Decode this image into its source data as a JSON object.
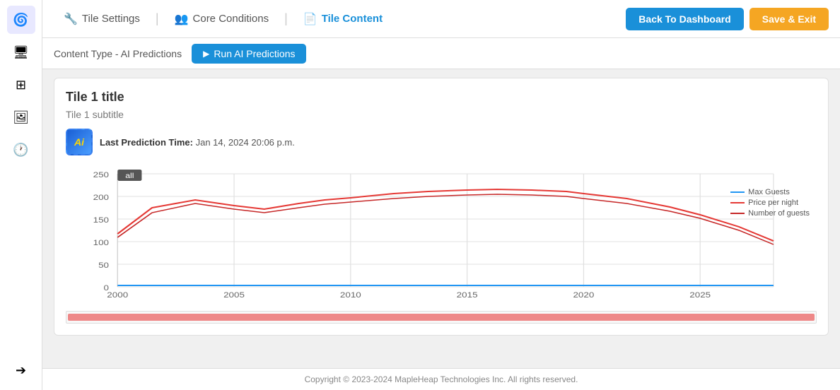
{
  "sidebar": {
    "icons": [
      {
        "name": "logo-icon",
        "symbol": "🌀",
        "active": true
      },
      {
        "name": "dashboard-icon",
        "symbol": "🖥"
      },
      {
        "name": "grid-icon",
        "symbol": "⊞"
      },
      {
        "name": "image-icon",
        "symbol": "🖼"
      },
      {
        "name": "clock-icon",
        "symbol": "🕐"
      },
      {
        "name": "arrow-right-icon",
        "symbol": "➔"
      }
    ]
  },
  "topnav": {
    "tabs": [
      {
        "id": "tile-settings",
        "icon": "🔧",
        "label": "Tile Settings",
        "active": false
      },
      {
        "id": "core-conditions",
        "icon": "👥",
        "label": "Core Conditions",
        "active": false
      },
      {
        "id": "tile-content",
        "icon": "📄",
        "label": "Tile Content",
        "active": true
      }
    ],
    "back_button": "Back To Dashboard",
    "save_button": "Save & Exit"
  },
  "subtoolbar": {
    "content_type_label": "Content Type - AI Predictions",
    "run_button": "Run AI Predictions"
  },
  "tile": {
    "title": "Tile 1 title",
    "subtitle": "Tile 1 subtitle",
    "ai_badge": "Ai",
    "prediction_label": "Last Prediction Time:",
    "prediction_time": "Jan 14, 2024 20:06 p.m."
  },
  "chart": {
    "y_labels": [
      "0",
      "50",
      "100",
      "150",
      "200",
      "250"
    ],
    "x_labels": [
      "2000",
      "2005",
      "2010",
      "2015",
      "2020",
      "2025"
    ],
    "range_label": "all",
    "legend": [
      {
        "label": "Max Guests",
        "color": "#2196F3"
      },
      {
        "label": "Price per night",
        "color": "#e53935"
      },
      {
        "label": "Number of guests",
        "color": "#c62828"
      }
    ]
  },
  "footer": {
    "text": "Copyright © 2023-2024 MapleHeap Technologies Inc. All rights reserved."
  }
}
